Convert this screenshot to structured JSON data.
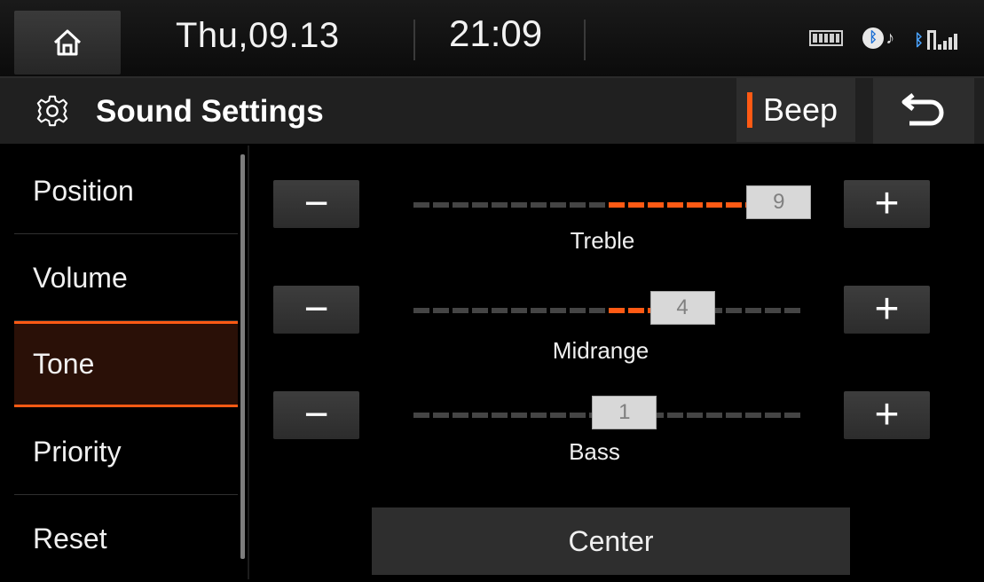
{
  "status_bar": {
    "home_icon": "home-icon",
    "date": "Thu,09.13",
    "time": "21:09",
    "icons": [
      "battery-icon",
      "bluetooth-audio-icon",
      "bluetooth-signal-icon"
    ]
  },
  "header": {
    "settings_icon": "gear-icon",
    "title": "Sound Settings",
    "beep_label": "Beep",
    "back_icon": "back-arrow-icon"
  },
  "menu": {
    "items": [
      {
        "label": "Position"
      },
      {
        "label": "Volume"
      },
      {
        "label": "Tone"
      },
      {
        "label": "Priority"
      },
      {
        "label": "Reset"
      }
    ],
    "selected": "Tone"
  },
  "tone": {
    "min": -10,
    "max": 10,
    "sliders": [
      {
        "name": "treble",
        "label": "Treble",
        "value": "9",
        "level": 9
      },
      {
        "name": "midrange",
        "label": "Midrange",
        "value": "4",
        "level": 4
      },
      {
        "name": "bass",
        "label": "Bass",
        "value": "1",
        "level": 1
      }
    ],
    "minus_symbol": "−",
    "plus_symbol": "+",
    "center_label": "Center"
  },
  "colors": {
    "accent": "#ff5a14",
    "background": "#000000",
    "panel": "#202020",
    "button": "#2e2e2e",
    "selected_bg": "#2a1007"
  }
}
